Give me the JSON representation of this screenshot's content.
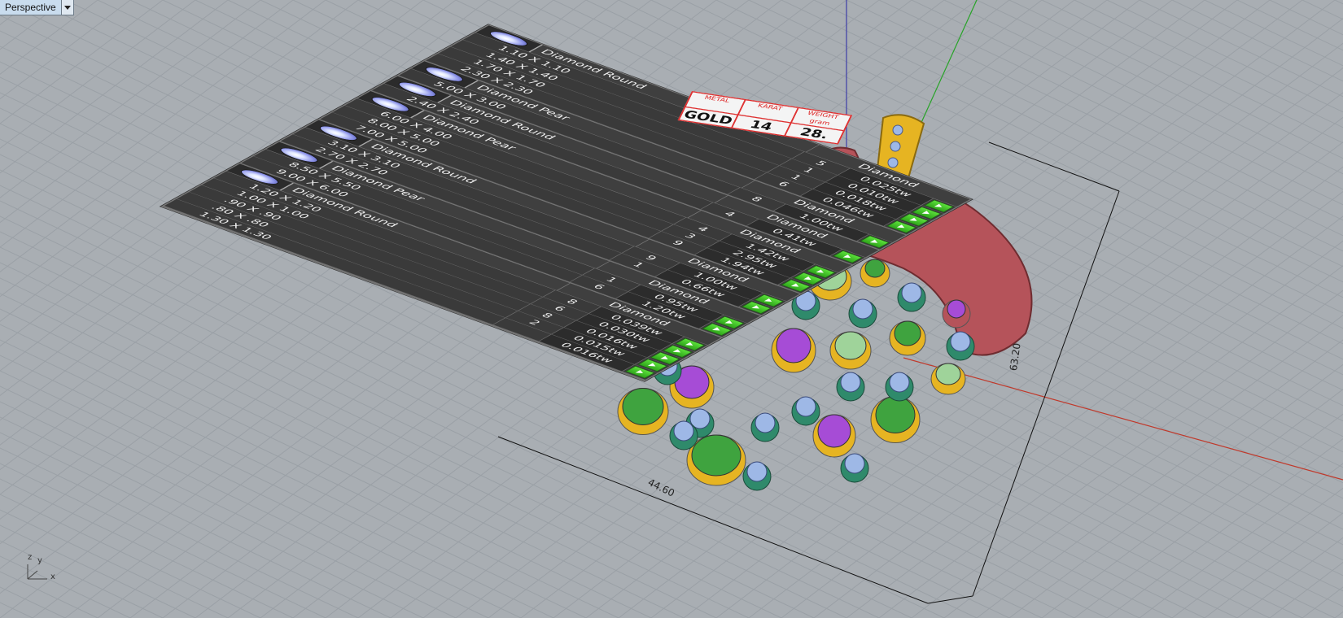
{
  "viewport": {
    "title": "Perspective"
  },
  "stone_table": {
    "groups": [
      {
        "title": "Diamond Round",
        "column_header": "Diamond",
        "rows": [
          {
            "size": "1.10 X 1.10",
            "qty": "5",
            "weight": "0.025tw"
          },
          {
            "size": "1.40 X 1.40",
            "qty": "1",
            "weight": "0.010tw"
          },
          {
            "size": "1.70 X 1.70",
            "qty": "1",
            "weight": "0.018tw"
          },
          {
            "size": "2.30 X 2.30",
            "qty": "6",
            "weight": "0.046tw"
          }
        ]
      },
      {
        "title": "Diamond Pear",
        "column_header": "Diamond",
        "rows": [
          {
            "size": "5.00 X 3.00",
            "qty": "8",
            "weight": "1.00tw"
          }
        ]
      },
      {
        "title": "Diamond Round",
        "column_header": "Diamond",
        "rows": [
          {
            "size": "2.40 X 2.40",
            "qty": "4",
            "weight": "0.41tw"
          }
        ]
      },
      {
        "title": "Diamond Pear",
        "column_header": "Diamond",
        "rows": [
          {
            "size": "6.00 X 4.00",
            "qty": "4",
            "weight": "1.42tw"
          },
          {
            "size": "8.00 X 5.00",
            "qty": "3",
            "weight": "2.95tw"
          },
          {
            "size": "7.00 X 5.00",
            "qty": "9",
            "weight": "1.94tw"
          }
        ]
      },
      {
        "title": "Diamond Round",
        "column_header": "Diamond",
        "rows": [
          {
            "size": "3.10 X 3.10",
            "qty": "9",
            "weight": "1.00tw"
          },
          {
            "size": "2.70 X 2.70",
            "qty": "1",
            "weight": "0.66tw"
          }
        ]
      },
      {
        "title": "Diamond Pear",
        "column_header": "Diamond",
        "rows": [
          {
            "size": "8.50 X 5.50",
            "qty": "1",
            "weight": "0.95tw"
          },
          {
            "size": "9.00 X 6.00",
            "qty": "6",
            "weight": "1.20tw"
          }
        ]
      },
      {
        "title": "Diamond Round",
        "column_header": "Diamond",
        "rows": [
          {
            "size": "1.20 X 1.20",
            "qty": "8",
            "weight": "0.039tw"
          },
          {
            "size": "1.00 X 1.00",
            "qty": "6",
            "weight": "0.030tw"
          },
          {
            "size": ".90 X .90",
            "qty": "8",
            "weight": "0.016tw"
          },
          {
            "size": ".80 X .80",
            "qty": "2",
            "weight": "0.015tw"
          },
          {
            "size": "1.30 X 1.30",
            "qty": "",
            "weight": "0.016tw"
          }
        ]
      }
    ]
  },
  "metal_label": {
    "headers": [
      "METAL",
      "KARAT",
      "WEIGHT gram"
    ],
    "values": [
      "GOLD",
      "14",
      "28."
    ]
  },
  "dimensions": {
    "width": "44.60",
    "height": "63.20"
  },
  "axis_gizmo": {
    "z": "z",
    "y": "y",
    "x": "x"
  },
  "colors": {
    "background": "#a9aeb3",
    "grid_line": "#9aa0a6",
    "axis_x": "#c0392b",
    "axis_y": "#27a327",
    "axis_z": "#3c3ca8",
    "metal_red": "#b5535a",
    "metal_yellow": "#e6b422",
    "gem_purple": "#a64cd6",
    "gem_green": "#3fa33f",
    "gem_light_green": "#9fd39a",
    "gem_blue": "#9eb8e6"
  }
}
